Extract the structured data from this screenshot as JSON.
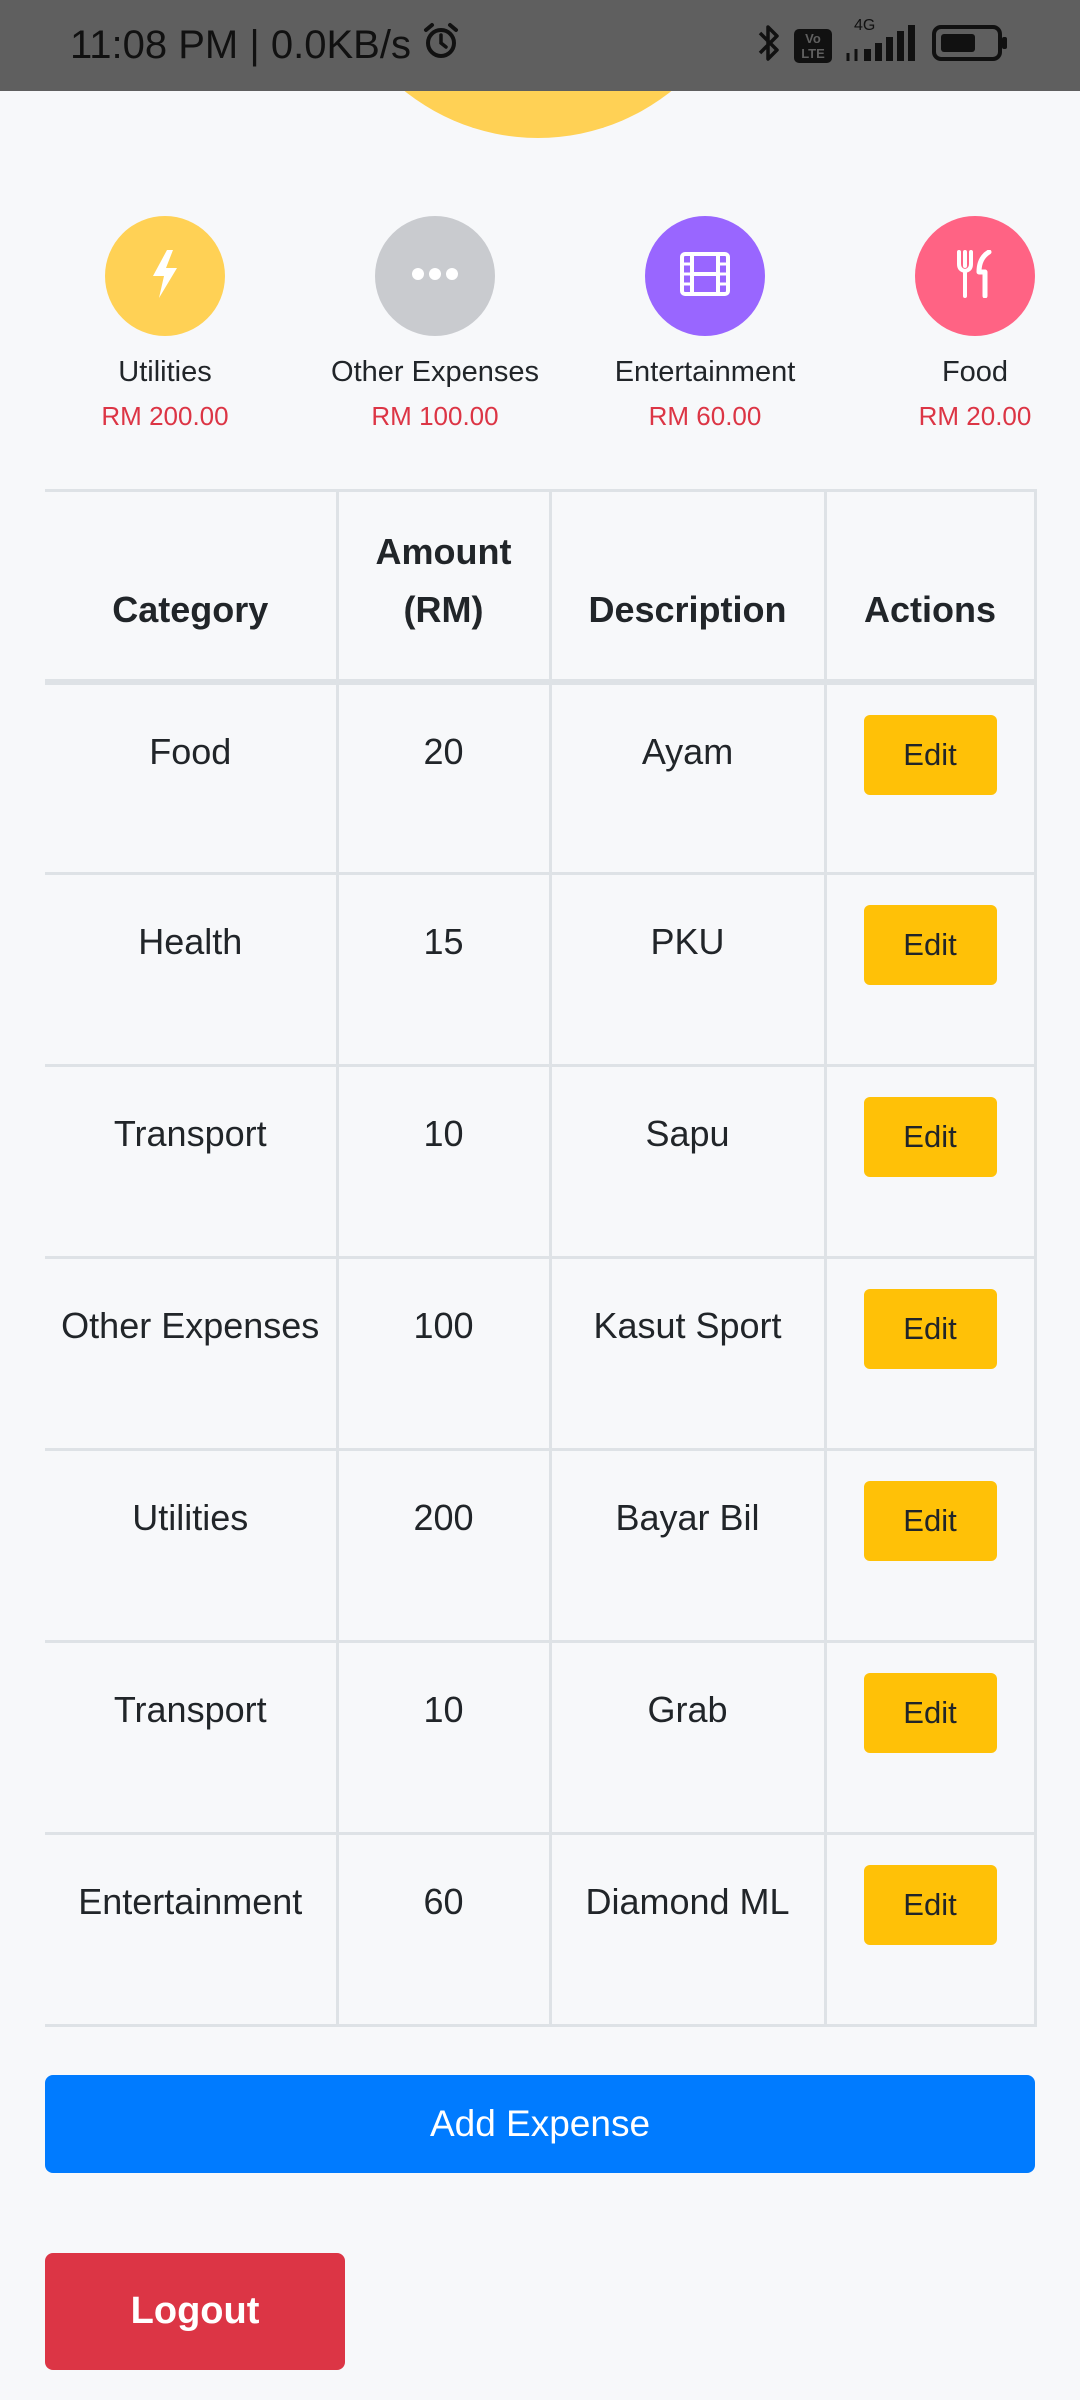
{
  "status_bar": {
    "time_net": "11:08 PM | 0.0KB/s",
    "volte_badge": "Vo LTE",
    "network_label": "4G"
  },
  "summary": [
    {
      "name": "Utilities",
      "amount": "RM 200.00",
      "color": "#ffd155",
      "icon": "bolt-icon"
    },
    {
      "name": "Other Expenses",
      "amount": "RM 100.00",
      "color": "#c9cbcf",
      "icon": "ellipsis-icon"
    },
    {
      "name": "Entertainment",
      "amount": "RM 60.00",
      "color": "#9966ff",
      "icon": "film-icon"
    },
    {
      "name": "Food",
      "amount": "RM 20.00",
      "color": "#ff6384",
      "icon": "utensils-icon"
    }
  ],
  "table": {
    "headers": {
      "category": "Category",
      "amount": "Amount (RM)",
      "description": "Description",
      "actions": "Actions"
    },
    "edit_label": "Edit",
    "rows": [
      {
        "category": "Food",
        "amount": "20",
        "description": "Ayam"
      },
      {
        "category": "Health",
        "amount": "15",
        "description": "PKU"
      },
      {
        "category": "Transport",
        "amount": "10",
        "description": "Sapu"
      },
      {
        "category": "Other Expenses",
        "amount": "100",
        "description": "Kasut Sport"
      },
      {
        "category": "Utilities",
        "amount": "200",
        "description": "Bayar Bil"
      },
      {
        "category": "Transport",
        "amount": "10",
        "description": "Grab"
      },
      {
        "category": "Entertainment",
        "amount": "60",
        "description": "Diamond ML"
      }
    ]
  },
  "buttons": {
    "add_expense": "Add Expense",
    "logout": "Logout"
  },
  "colors": {
    "edit_button": "#ffc107",
    "add_button": "#007bff",
    "logout_button": "#dc3545",
    "amount_text": "#dc3545"
  }
}
